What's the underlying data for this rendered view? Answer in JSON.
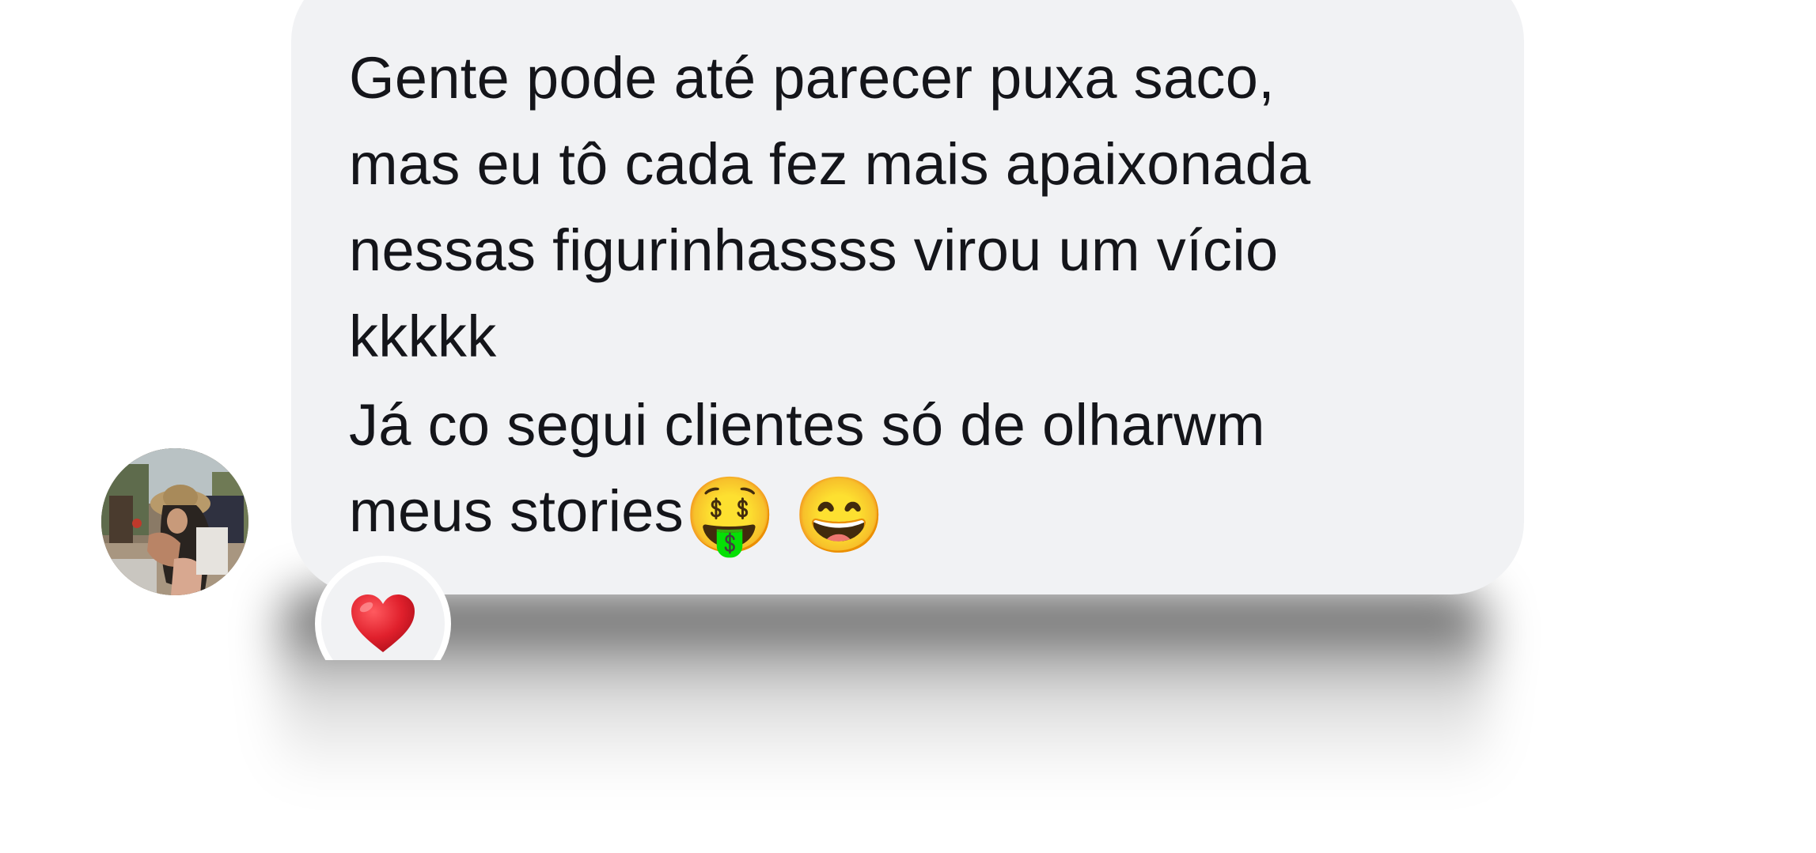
{
  "message": {
    "lines": [
      "Gente pode até parecer puxa saco,",
      "mas eu tô cada fez mais apaixonada",
      "nessas figurinhassss virou um vício",
      "kkkkk",
      "Já co segui clientes só de olharwm",
      "meus stories"
    ],
    "trailing_emojis": [
      "🤑",
      "😄"
    ]
  },
  "reaction": {
    "emoji": "❤️",
    "icon": "heart-icon"
  },
  "avatar": {
    "icon": "user-avatar"
  },
  "colors": {
    "bubble": "#f1f2f4",
    "text": "#14151a",
    "heart": "#e0202c"
  }
}
